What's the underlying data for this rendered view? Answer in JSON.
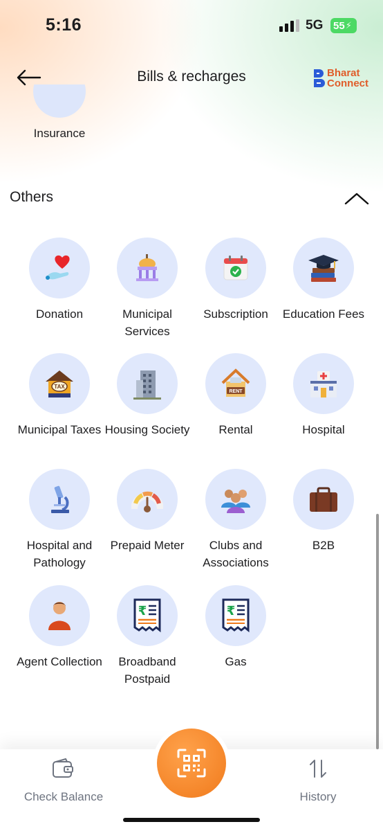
{
  "status_bar": {
    "time": "5:16",
    "network": "5G",
    "battery": "55"
  },
  "header": {
    "title": "Bills & recharges",
    "brand_line1": "Bharat",
    "brand_line2": "Connect"
  },
  "above_section": {
    "label": "Insurance"
  },
  "section": {
    "title": "Others"
  },
  "tiles": [
    {
      "label": "Donation",
      "icon": "heart-hand-icon"
    },
    {
      "label": "Municipal Services",
      "icon": "municipal-building-icon"
    },
    {
      "label": "Subscription",
      "icon": "calendar-check-icon"
    },
    {
      "label": "Education Fees",
      "icon": "books-graduation-cap-icon"
    },
    {
      "label": "Municipal Taxes",
      "icon": "tax-house-icon"
    },
    {
      "label": "Housing Society",
      "icon": "apartment-building-icon"
    },
    {
      "label": "Rental",
      "icon": "rent-house-icon"
    },
    {
      "label": "Hospital",
      "icon": "hospital-icon"
    },
    {
      "label": "Hospital and Pathology",
      "icon": "microscope-icon"
    },
    {
      "label": "Prepaid Meter",
      "icon": "meter-gauge-icon"
    },
    {
      "label": "Clubs and Associations",
      "icon": "people-group-icon"
    },
    {
      "label": "B2B",
      "icon": "briefcase-icon"
    },
    {
      "label": "Agent Collection",
      "icon": "agent-person-icon"
    },
    {
      "label": "Broadband Postpaid",
      "icon": "rupee-bill-icon"
    },
    {
      "label": "Gas",
      "icon": "rupee-bill-icon"
    }
  ],
  "bottom_nav": {
    "check_balance": "Check Balance",
    "history": "History"
  },
  "colors": {
    "accent_orange": "#f07a1c",
    "tile_bg": "#e0e8fc",
    "brand_blue": "#2a5bd7",
    "brand_orange": "#e05d2a"
  }
}
